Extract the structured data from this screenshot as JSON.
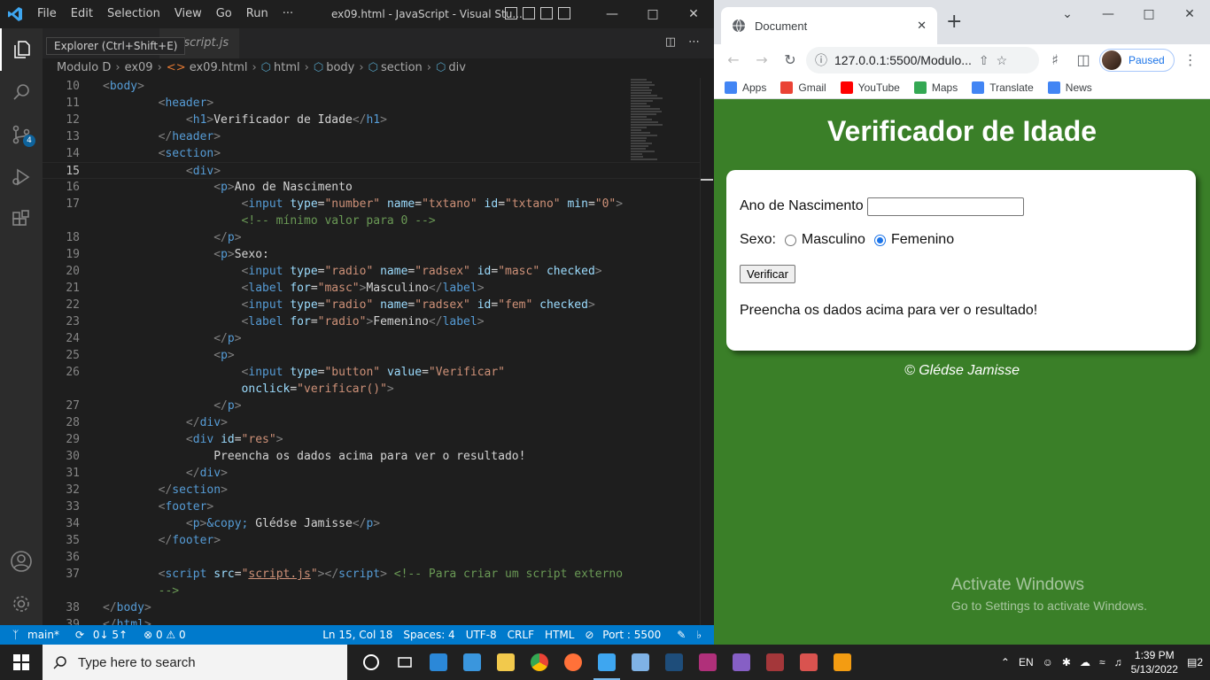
{
  "vscode": {
    "menu": [
      "File",
      "Edit",
      "Selection",
      "View",
      "Go",
      "Run",
      "···"
    ],
    "window_title": "ex09.html - JavaScript - Visual Stu...",
    "tab_label": "script.js",
    "tooltip": "Explorer (Ctrl+Shift+E)",
    "source_control_badge": "4",
    "breadcrumb": [
      "Modulo D",
      "ex09",
      "ex09.html",
      "html",
      "body",
      "section",
      "div"
    ],
    "lines": [
      {
        "n": "10",
        "html": "<span class='t'>&lt;</span><span class='tag'>body</span><span class='t'>&gt;</span>"
      },
      {
        "n": "11",
        "html": "        <span class='t'>&lt;</span><span class='tag'>header</span><span class='t'>&gt;</span>"
      },
      {
        "n": "12",
        "html": "            <span class='t'>&lt;</span><span class='tag'>h1</span><span class='t'>&gt;</span>Verificador de Idade<span class='t'>&lt;/</span><span class='tag'>h1</span><span class='t'>&gt;</span>"
      },
      {
        "n": "13",
        "html": "        <span class='t'>&lt;/</span><span class='tag'>header</span><span class='t'>&gt;</span>"
      },
      {
        "n": "14",
        "html": "        <span class='t'>&lt;</span><span class='tag'>section</span><span class='t'>&gt;</span>"
      },
      {
        "n": "15",
        "html": "            <span class='t'>&lt;</span><span class='tag'>div</span><span class='t'>&gt;</span>",
        "current": true
      },
      {
        "n": "16",
        "html": "                <span class='t'>&lt;</span><span class='tag'>p</span><span class='t'>&gt;</span>Ano de Nascimento"
      },
      {
        "n": "17",
        "html": "                    <span class='t'>&lt;</span><span class='tag'>input</span> <span class='attr'>type</span>=<span class='str'>\"number\"</span> <span class='attr'>name</span>=<span class='str'>\"txtano\"</span> <span class='attr'>id</span>=<span class='str'>\"txtano\"</span> <span class='attr'>min</span>=<span class='str'>\"0\"</span><span class='t'>&gt;</span>"
      },
      {
        "n": "",
        "html": "                    <span class='cm'>&lt;!-- mínimo valor para 0 --&gt;</span>"
      },
      {
        "n": "18",
        "html": "                <span class='t'>&lt;/</span><span class='tag'>p</span><span class='t'>&gt;</span>"
      },
      {
        "n": "19",
        "html": "                <span class='t'>&lt;</span><span class='tag'>p</span><span class='t'>&gt;</span>Sexo:"
      },
      {
        "n": "20",
        "html": "                    <span class='t'>&lt;</span><span class='tag'>input</span> <span class='attr'>type</span>=<span class='str'>\"radio\"</span> <span class='attr'>name</span>=<span class='str'>\"radsex\"</span> <span class='attr'>id</span>=<span class='str'>\"masc\"</span> <span class='attr'>checked</span><span class='t'>&gt;</span>"
      },
      {
        "n": "21",
        "html": "                    <span class='t'>&lt;</span><span class='tag'>label</span> <span class='attr'>for</span>=<span class='str'>\"masc\"</span><span class='t'>&gt;</span>Masculino<span class='t'>&lt;/</span><span class='tag'>label</span><span class='t'>&gt;</span>"
      },
      {
        "n": "22",
        "html": "                    <span class='t'>&lt;</span><span class='tag'>input</span> <span class='attr'>type</span>=<span class='str'>\"radio\"</span> <span class='attr'>name</span>=<span class='str'>\"radsex\"</span> <span class='attr'>id</span>=<span class='str'>\"fem\"</span> <span class='attr'>checked</span><span class='t'>&gt;</span>"
      },
      {
        "n": "23",
        "html": "                    <span class='t'>&lt;</span><span class='tag'>label</span> <span class='attr'>for</span>=<span class='str'>\"radio\"</span><span class='t'>&gt;</span>Femenino<span class='t'>&lt;/</span><span class='tag'>label</span><span class='t'>&gt;</span>"
      },
      {
        "n": "24",
        "html": "                <span class='t'>&lt;/</span><span class='tag'>p</span><span class='t'>&gt;</span>"
      },
      {
        "n": "25",
        "html": "                <span class='t'>&lt;</span><span class='tag'>p</span><span class='t'>&gt;</span>"
      },
      {
        "n": "26",
        "html": "                    <span class='t'>&lt;</span><span class='tag'>input</span> <span class='attr'>type</span>=<span class='str'>\"button\"</span> <span class='attr'>value</span>=<span class='str'>\"Verificar\"</span>"
      },
      {
        "n": "",
        "html": "                    <span class='attr'>onclick</span>=<span class='str'>\"verificar()\"</span><span class='t'>&gt;</span>"
      },
      {
        "n": "27",
        "html": "                <span class='t'>&lt;/</span><span class='tag'>p</span><span class='t'>&gt;</span>"
      },
      {
        "n": "28",
        "html": "            <span class='t'>&lt;/</span><span class='tag'>div</span><span class='t'>&gt;</span>"
      },
      {
        "n": "29",
        "html": "            <span class='t'>&lt;</span><span class='tag'>div</span> <span class='attr'>id</span>=<span class='str'>\"res\"</span><span class='t'>&gt;</span>"
      },
      {
        "n": "30",
        "html": "                Preencha os dados acima para ver o resultado!"
      },
      {
        "n": "31",
        "html": "            <span class='t'>&lt;/</span><span class='tag'>div</span><span class='t'>&gt;</span>"
      },
      {
        "n": "32",
        "html": "        <span class='t'>&lt;/</span><span class='tag'>section</span><span class='t'>&gt;</span>"
      },
      {
        "n": "33",
        "html": "        <span class='t'>&lt;</span><span class='tag'>footer</span><span class='t'>&gt;</span>"
      },
      {
        "n": "34",
        "html": "            <span class='t'>&lt;</span><span class='tag'>p</span><span class='t'>&gt;</span><span class='ent'>&amp;copy;</span> Glédse Jamisse<span class='t'>&lt;/</span><span class='tag'>p</span><span class='t'>&gt;</span>"
      },
      {
        "n": "35",
        "html": "        <span class='t'>&lt;/</span><span class='tag'>footer</span><span class='t'>&gt;</span>"
      },
      {
        "n": "36",
        "html": ""
      },
      {
        "n": "37",
        "html": "        <span class='t'>&lt;</span><span class='tag'>script</span> <span class='attr'>src</span>=<span class='str'>\"<u>script.js</u>\"</span><span class='t'>&gt;&lt;/</span><span class='tag'>script</span><span class='t'>&gt;</span> <span class='cm'>&lt;!-- Para criar um script externo</span>"
      },
      {
        "n": "",
        "html": "        <span class='cm'>--&gt;</span>"
      },
      {
        "n": "38",
        "html": "<span class='t'>&lt;/</span><span class='tag'>body</span><span class='t'>&gt;</span>"
      },
      {
        "n": "39",
        "html": "<span class='t'>&lt;/</span><span class='tag'>html</span><span class='t'>&gt;</span>"
      }
    ],
    "status": {
      "branch": "main*",
      "sync": "0↓ 5↑",
      "problems": "⊗ 0 ⚠ 0",
      "position": "Ln 15, Col 18",
      "spaces": "Spaces: 4",
      "encoding": "UTF-8",
      "eol": "CRLF",
      "language": "HTML",
      "port": "Port : 5500"
    }
  },
  "chrome": {
    "tab_title": "Document",
    "url": "127.0.0.1:5500/Modulo...",
    "profile_status": "Paused",
    "bookmarks": [
      {
        "label": "Apps",
        "color": "#4285f4"
      },
      {
        "label": "Gmail",
        "color": "#ea4335"
      },
      {
        "label": "YouTube",
        "color": "#ff0000"
      },
      {
        "label": "Maps",
        "color": "#34a853"
      },
      {
        "label": "Translate",
        "color": "#4285f4"
      },
      {
        "label": "News",
        "color": "#4285f4"
      }
    ]
  },
  "page": {
    "heading": "Verificador de Idade",
    "birth_year_label": "Ano de Nascimento",
    "sex_label": "Sexo:",
    "male_label": "Masculino",
    "female_label": "Femenino",
    "verify_button": "Verificar",
    "result": "Preencha os dados acima para ver o resultado!",
    "footer": "© Glédse Jamisse",
    "bg_color": "#3a7f28"
  },
  "watermark": {
    "line1": "Activate Windows",
    "line2": "Go to Settings to activate Windows."
  },
  "taskbar": {
    "search_placeholder": "Type here to search",
    "language": "EN",
    "time": "1:39 PM",
    "date": "5/13/2022",
    "notifications": "2"
  }
}
